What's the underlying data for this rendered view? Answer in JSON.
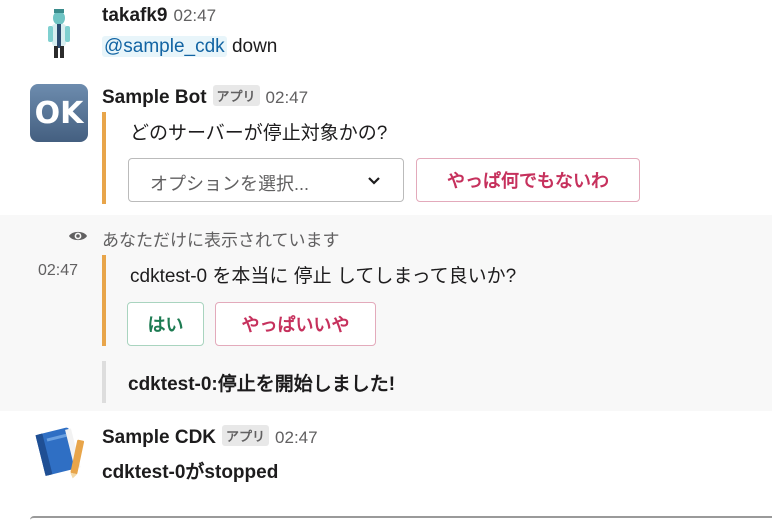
{
  "messages": [
    {
      "user": "takafk9",
      "time": "02:47",
      "mention": "@sample_cdk",
      "text": "down"
    },
    {
      "user": "Sample Bot",
      "badge": "アプリ",
      "time": "02:47",
      "avatar_text": "OK",
      "question": "どのサーバーが停止対象かの?",
      "select_placeholder": "オプションを選択...",
      "cancel_button": "やっぱ何でもないわ"
    }
  ],
  "ephemeral": {
    "label": "あなただけに表示されています",
    "time": "02:47",
    "question": "cdktest-0 を本当に 停止 してしまって良いか?",
    "yes_button": "はい",
    "no_button": "やっぱいいや",
    "result": "cdktest-0:停止を開始しました!"
  },
  "cdk": {
    "user": "Sample CDK",
    "badge": "アプリ",
    "time": "02:47",
    "text": "cdktest-0がstopped"
  },
  "colors": {
    "attachment_bar": "#e8a54a",
    "danger": "#c6315d",
    "primary": "#1d7b52",
    "mention_bg": "#e8f5fa",
    "mention_text": "#1264a3"
  }
}
